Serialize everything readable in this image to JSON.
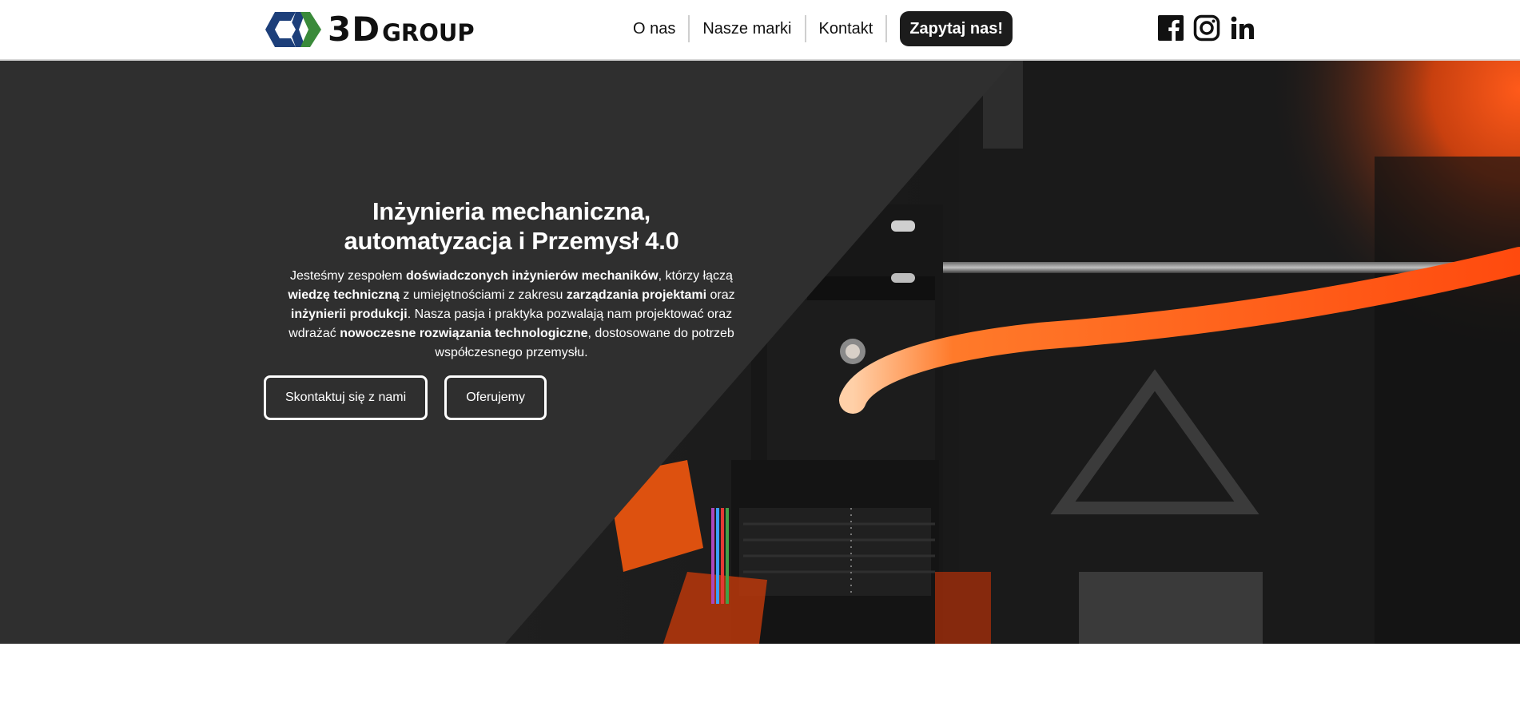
{
  "header": {
    "logo": {
      "mark": "3d-group-logo-mark",
      "text_3d": "3D",
      "text_group": "GROUP"
    },
    "nav": [
      {
        "label": "O nas"
      },
      {
        "label": "Nasze marki"
      },
      {
        "label": "Kontakt"
      }
    ],
    "cta_label": "Zapytaj nas!",
    "social": [
      {
        "icon": "facebook-icon"
      },
      {
        "icon": "instagram-icon"
      },
      {
        "icon": "linkedin-icon"
      }
    ]
  },
  "hero": {
    "title": "Inżynieria mechaniczna, automatyzacja i Przemysł 4.0",
    "text": [
      {
        "t": "Jesteśmy zespołem ",
        "bold": false
      },
      {
        "t": "doświadczonych inżynierów mechaników",
        "bold": true
      },
      {
        "t": ", którzy łączą ",
        "bold": false
      },
      {
        "t": "wiedzę techniczną",
        "bold": true
      },
      {
        "t": " z umiejętnościami z zakresu ",
        "bold": false
      },
      {
        "t": "zarządzania projektami",
        "bold": true
      },
      {
        "t": " oraz ",
        "bold": false
      },
      {
        "t": "inżynierii produkcji",
        "bold": true
      },
      {
        "t": ". Nasza pasja i praktyka pozwalają nam projektować oraz wdrażać ",
        "bold": false
      },
      {
        "t": "nowoczesne rozwiązania technologiczne",
        "bold": true
      },
      {
        "t": ", dostosowane do potrzeb współczesnego przemysłu.",
        "bold": false
      }
    ],
    "buttons": {
      "contact": "Skontaktuj się z nami",
      "offer": "Oferujemy"
    },
    "background": "3d-printer-extruder-photo"
  },
  "colors": {
    "dark_panel": "#2f2f2f",
    "cta_bg": "#1c1c1c",
    "logo_blue": "#1d3f7a",
    "logo_green": "#3a8a3a",
    "filament_orange": "#ff5a1a"
  }
}
